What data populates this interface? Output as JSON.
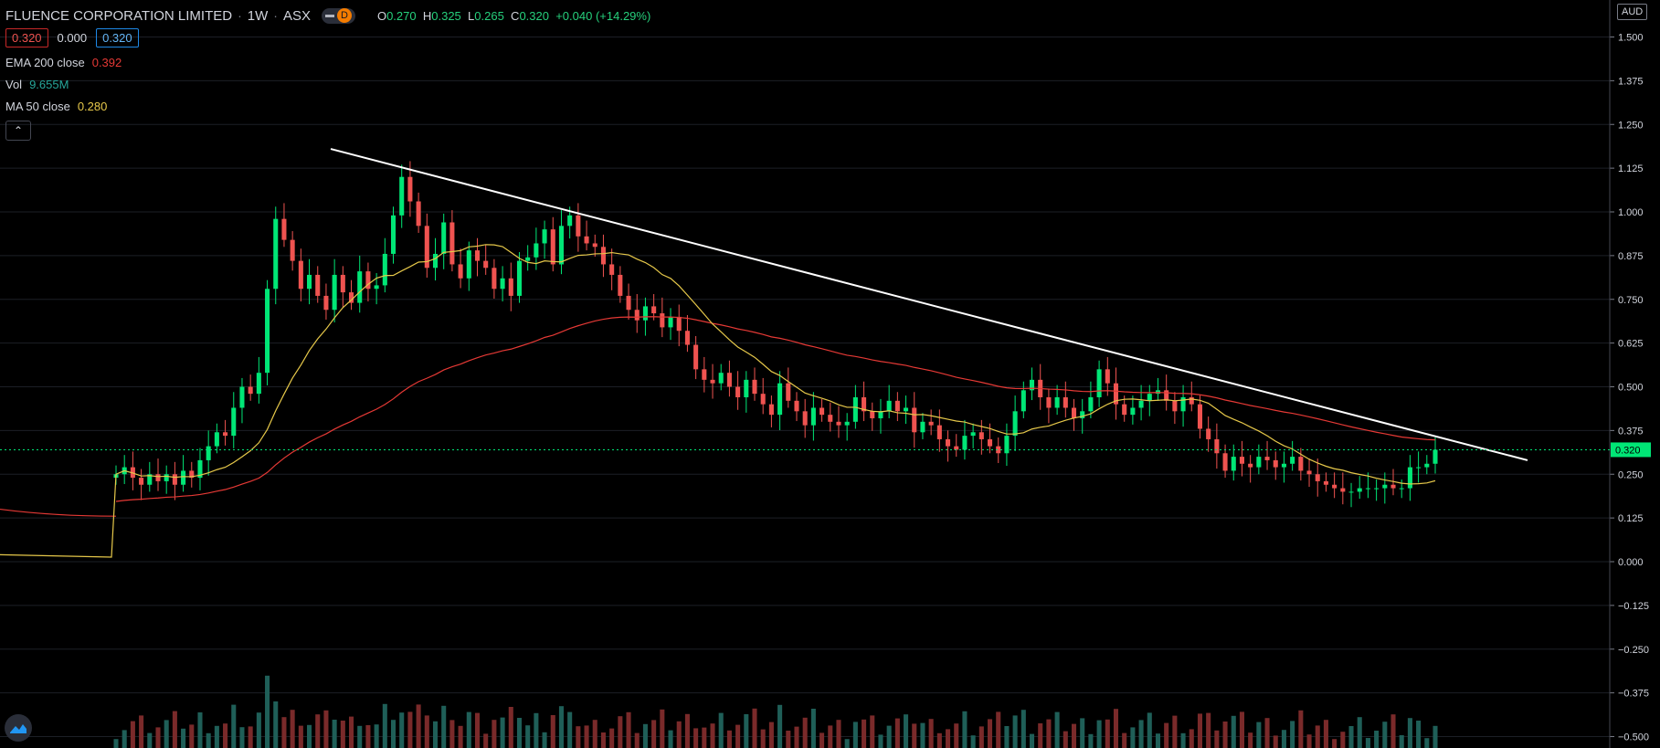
{
  "header": {
    "symbol": "FLUENCE CORPORATION LIMITED",
    "interval": "1W",
    "exchange": "ASX",
    "interval_badge": "D",
    "ohlc": {
      "o_label": "O",
      "o": "0.270",
      "h_label": "H",
      "h": "0.325",
      "l_label": "L",
      "l": "0.265",
      "c_label": "C",
      "c": "0.320",
      "change": "+0.040 (+14.29%)"
    }
  },
  "price_boxes": {
    "bid": "0.320",
    "spread": "0.000",
    "ask": "0.320"
  },
  "indicators": {
    "ema": {
      "label": "EMA 200 close",
      "value": "0.392"
    },
    "vol": {
      "label": "Vol",
      "value": "9.655M"
    },
    "ma": {
      "label": "MA 50 close",
      "value": "0.280"
    }
  },
  "currency": "AUD",
  "last_price_label": "0.320",
  "colors": {
    "up": "#26a69a",
    "up_candle": "#00e676",
    "down": "#ef5350",
    "ema": "#e53935",
    "ma": "#e6c84a",
    "trendline": "#ffffff",
    "vol_up": "#1f5f58",
    "vol_down": "#7a2a2a",
    "last": "#00e676"
  },
  "chart_data": {
    "type": "candlestick",
    "y_axis": {
      "ticks": [
        "1.500",
        "1.375",
        "1.250",
        "1.125",
        "1.000",
        "0.875",
        "0.750",
        "0.625",
        "0.500",
        "0.375",
        "0.250",
        "0.125",
        "0.000",
        "−0.125",
        "−0.250",
        "−0.375",
        "−0.500"
      ],
      "range": [
        -0.53,
        1.6
      ]
    },
    "close": [
      0.25,
      0.27,
      0.24,
      0.22,
      0.25,
      0.23,
      0.25,
      0.22,
      0.26,
      0.24,
      0.29,
      0.33,
      0.37,
      0.36,
      0.44,
      0.5,
      0.48,
      0.54,
      0.78,
      0.98,
      0.92,
      0.86,
      0.78,
      0.82,
      0.76,
      0.72,
      0.82,
      0.77,
      0.74,
      0.83,
      0.78,
      0.79,
      0.88,
      0.99,
      1.1,
      1.03,
      0.96,
      0.84,
      0.88,
      0.97,
      0.85,
      0.81,
      0.89,
      0.86,
      0.84,
      0.78,
      0.81,
      0.76,
      0.86,
      0.87,
      0.91,
      0.95,
      0.85,
      0.96,
      0.99,
      0.93,
      0.91,
      0.9,
      0.85,
      0.82,
      0.76,
      0.72,
      0.69,
      0.73,
      0.71,
      0.67,
      0.7,
      0.66,
      0.62,
      0.55,
      0.52,
      0.51,
      0.54,
      0.5,
      0.47,
      0.52,
      0.48,
      0.45,
      0.42,
      0.51,
      0.46,
      0.43,
      0.39,
      0.44,
      0.42,
      0.4,
      0.39,
      0.4,
      0.47,
      0.43,
      0.41,
      0.43,
      0.46,
      0.43,
      0.44,
      0.37,
      0.4,
      0.39,
      0.35,
      0.33,
      0.32,
      0.36,
      0.37,
      0.35,
      0.33,
      0.31,
      0.36,
      0.43,
      0.49,
      0.52,
      0.47,
      0.44,
      0.47,
      0.44,
      0.41,
      0.43,
      0.47,
      0.55,
      0.51,
      0.45,
      0.42,
      0.44,
      0.46,
      0.48,
      0.49,
      0.46,
      0.43,
      0.47,
      0.45,
      0.38,
      0.35,
      0.31,
      0.26,
      0.3,
      0.28,
      0.27,
      0.3,
      0.29,
      0.27,
      0.28,
      0.3,
      0.26,
      0.25,
      0.23,
      0.22,
      0.21,
      0.2,
      0.2,
      0.21,
      0.21,
      0.21,
      0.22,
      0.21,
      0.21,
      0.27,
      0.27,
      0.28,
      0.32
    ],
    "ema200_close_last": 0.392,
    "ma50_close_last": 0.28,
    "volume_last": "9.655M",
    "trendline": {
      "from_price": 1.18,
      "to_price": 0.29
    },
    "grid": true
  }
}
